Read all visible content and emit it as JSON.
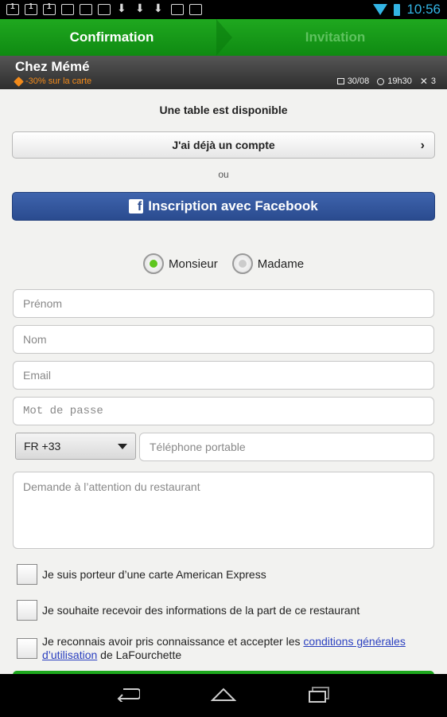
{
  "status_bar": {
    "time": "10:56"
  },
  "tabs": {
    "confirmation": "Confirmation",
    "invitation": "Invitation"
  },
  "restaurant": {
    "name": "Chez Mémé",
    "promo": "-30% sur la carte",
    "date": "30/08",
    "time": "19h30",
    "people": "3"
  },
  "main": {
    "availability": "Une table est disponible",
    "account_button": "J'ai déjà un compte",
    "or_label": "ou",
    "facebook_button": "Inscription avec Facebook"
  },
  "form": {
    "title_options": [
      {
        "label": "Monsieur",
        "selected": true
      },
      {
        "label": "Madame",
        "selected": false
      }
    ],
    "first_name_placeholder": "Prénom",
    "last_name_placeholder": "Nom",
    "email_placeholder": "Email",
    "password_placeholder": "Mot de passe",
    "country_code": "FR +33",
    "phone_placeholder": "Téléphone portable",
    "request_placeholder": "Demande à l’attention du restaurant"
  },
  "checkboxes": {
    "amex": "Je suis porteur d’une carte American Express",
    "newsletter": "Je souhaite recevoir des informations de la part de ce restaurant",
    "terms_prefix": "Je reconnais avoir pris connaissance et accepter les ",
    "terms_link": "conditions générales d’utilisation",
    "terms_suffix": " de LaFourchette"
  },
  "colors": {
    "accent_green": "#1fa81f",
    "facebook_blue": "#3b5998",
    "promo_orange": "#f28a1a",
    "status_blue": "#33b5e5"
  }
}
